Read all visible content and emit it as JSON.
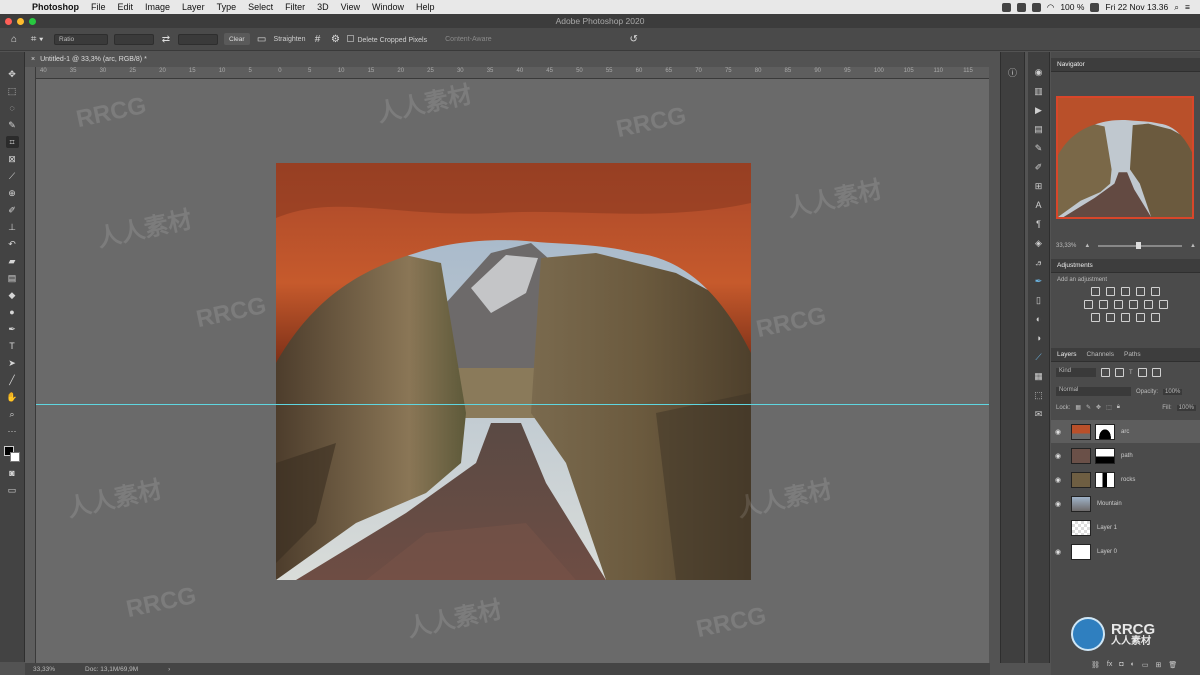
{
  "menubar": {
    "app": "Photoshop",
    "menus": [
      "File",
      "Edit",
      "Image",
      "Layer",
      "Type",
      "Select",
      "Filter",
      "3D",
      "View",
      "Window",
      "Help"
    ],
    "battery": "100 %",
    "datetime": "Fri 22 Nov  13.36"
  },
  "window": {
    "title": "Adobe Photoshop 2020"
  },
  "options": {
    "ratio": "Ratio",
    "clear": "Clear",
    "straighten": "Straighten",
    "delete_cropped": "Delete Cropped Pixels",
    "content_aware": "Content-Aware"
  },
  "document": {
    "tab": "Untitled-1 @ 33,3% (arc, RGB/8) *"
  },
  "ruler_ticks": [
    "40",
    "35",
    "30",
    "25",
    "20",
    "15",
    "10",
    "5",
    "0",
    "5",
    "10",
    "15",
    "20",
    "25",
    "30",
    "35",
    "40",
    "45",
    "50",
    "55",
    "60",
    "65",
    "70",
    "75",
    "80",
    "85",
    "90",
    "95",
    "100",
    "105",
    "110",
    "115"
  ],
  "statusbar": {
    "zoom": "33,33%",
    "doc": "Doc: 13,1M/69,9M"
  },
  "navigator": {
    "title": "Navigator",
    "zoom": "33,33%"
  },
  "adjustments": {
    "title": "Adjustments",
    "subtitle": "Add an adjustment"
  },
  "layers_panel": {
    "tabs": [
      "Layers",
      "Channels",
      "Paths"
    ],
    "kind": "Kind",
    "blend": "Normal",
    "opacity_label": "Opacity:",
    "opacity": "100%",
    "lock_label": "Lock:",
    "fill_label": "Fill:",
    "fill": "100%",
    "layers": [
      {
        "name": "arc",
        "visible": true,
        "selected": true
      },
      {
        "name": "path",
        "visible": true,
        "selected": false
      },
      {
        "name": "rocks",
        "visible": true,
        "selected": false
      },
      {
        "name": "Mountain",
        "visible": true,
        "selected": false
      },
      {
        "name": "Layer 1",
        "visible": false,
        "selected": false
      },
      {
        "name": "Layer 0",
        "visible": true,
        "selected": false
      }
    ]
  },
  "watermark": {
    "latin": "RRCG",
    "cjk": "人人素材"
  },
  "colors": {
    "guide": "#5fd6e0",
    "panel": "#4b4b4b",
    "canvas": "#6a6a6a",
    "nav_frame": "#d8462a"
  }
}
